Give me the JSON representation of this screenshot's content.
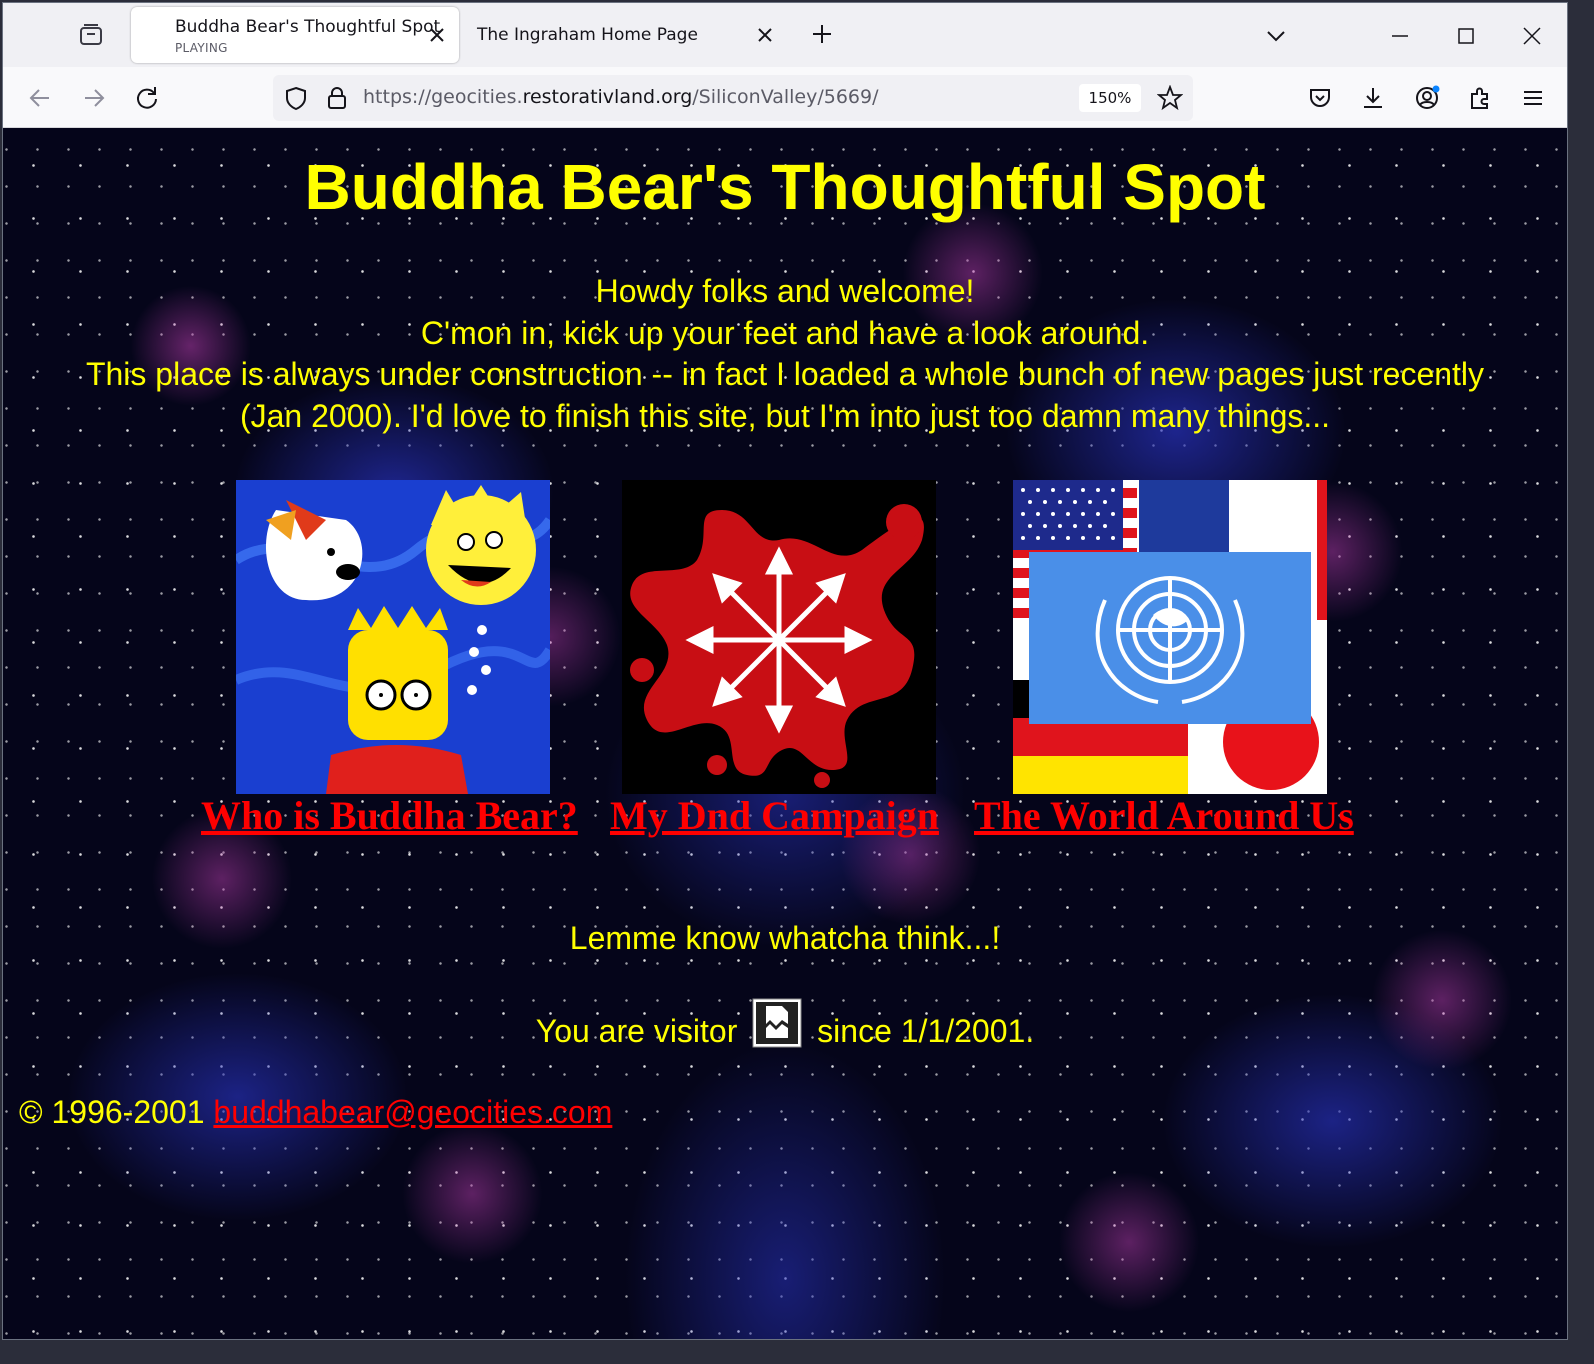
{
  "browser": {
    "tabs": [
      {
        "title": "Buddha Bear's Thoughtful Spot",
        "subtitle": "PLAYING",
        "active": true
      },
      {
        "title": "The Ingraham Home Page",
        "active": false
      }
    ],
    "url_prefix": "https://geocities.",
    "url_domain": "restorativland.org",
    "url_path": "/SiliconValley/5669/",
    "zoom": "150%"
  },
  "page": {
    "title": "Buddha Bear's Thoughtful Spot",
    "intro_lines": [
      "Howdy folks and welcome!",
      "C'mon in, kick up your feet and have a look around.",
      "This place is always under construction -- in fact I loaded a whole bunch of new pages just recently",
      "(Jan 2000). I'd love to finish this site, but I'm into just too damn many things..."
    ],
    "links": [
      {
        "label": "Who is Buddha Bear?",
        "image": "cartoon-characters-image"
      },
      {
        "label": "My Dnd Campaign",
        "image": "chaos-star-splat-image"
      },
      {
        "label": "The World Around Us",
        "image": "world-flags-image"
      }
    ],
    "feedback": "Lemme know whatcha think...!",
    "visitor_before": "You are visitor",
    "visitor_after": "since 1/1/2001.",
    "copyright": "© 1996-2001",
    "email": "buddhabear@geocities.com"
  },
  "colors": {
    "text": "#ffff00",
    "link": "#ff0000",
    "background": "#05051a"
  }
}
